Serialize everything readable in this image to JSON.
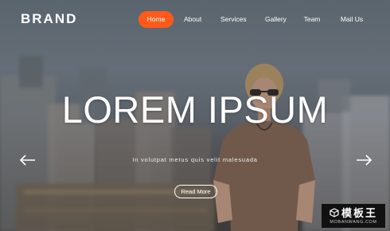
{
  "brand": {
    "name": "BRAND"
  },
  "nav": {
    "items": [
      {
        "label": "Home",
        "active": true
      },
      {
        "label": "About",
        "active": false
      },
      {
        "label": "Services",
        "active": false
      },
      {
        "label": "Gallery",
        "active": false
      },
      {
        "label": "Team",
        "active": false
      },
      {
        "label": "Mail Us",
        "active": false
      }
    ]
  },
  "hero": {
    "title": "LOREM IPSUM",
    "subtitle": "In volutpat metus quis velit malesuada",
    "button_label": "Read More"
  },
  "carousel": {
    "prev_icon": "arrow-left-icon",
    "next_icon": "arrow-right-icon"
  },
  "watermark": {
    "main": "模板王",
    "sub": "MOBANWANG.COM"
  },
  "colors": {
    "accent": "#ff5a1a",
    "text": "#ffffff"
  }
}
